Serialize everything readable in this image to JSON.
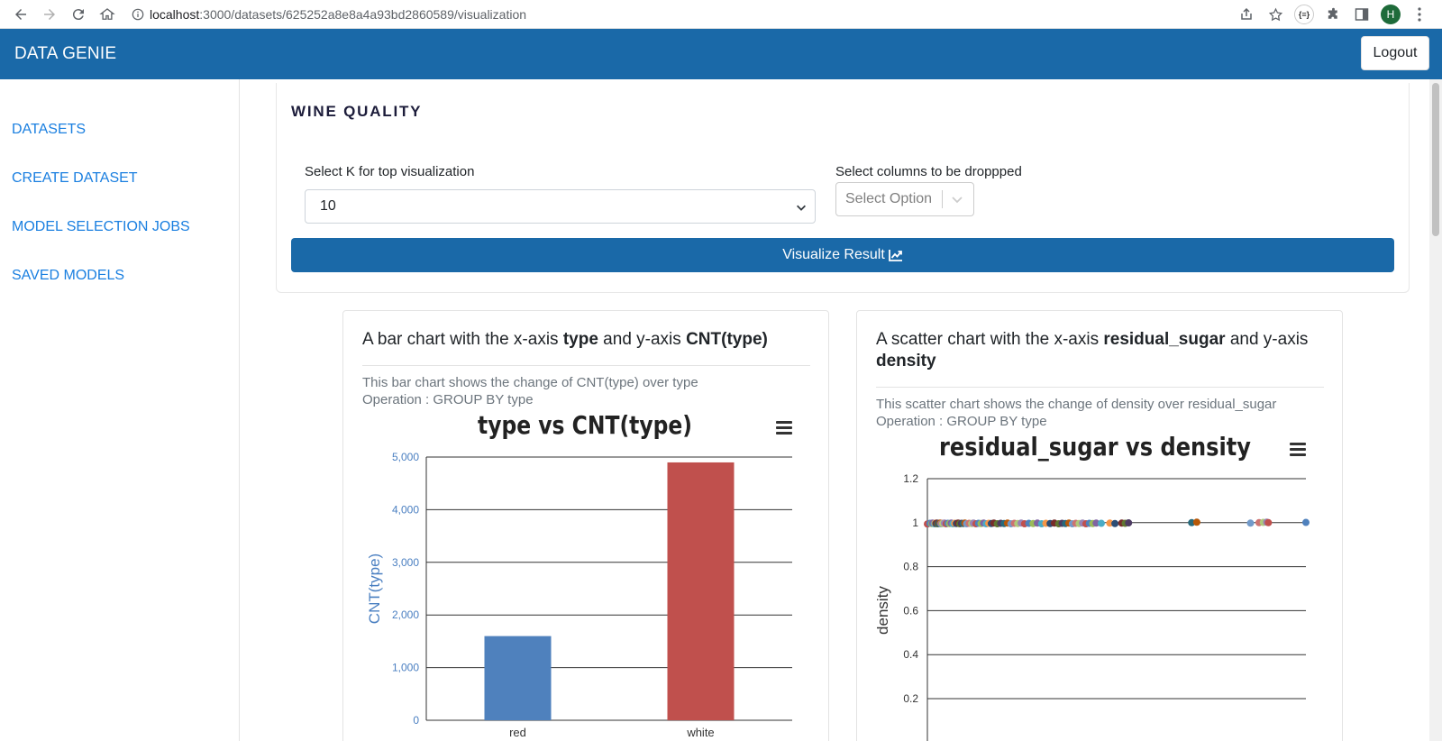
{
  "browser": {
    "url_host": "localhost",
    "url_rest": ":3000/datasets/625252a8e8a4a93bd2860589/visualization",
    "extension_badge": "{≡}",
    "profile_initial": "H"
  },
  "header": {
    "brand": "DATA GENIE",
    "logout_label": "Logout"
  },
  "sidebar": {
    "items": [
      {
        "label": "DATASETS"
      },
      {
        "label": "CREATE DATASET"
      },
      {
        "label": "MODEL SELECTION JOBS"
      },
      {
        "label": "SAVED MODELS"
      }
    ]
  },
  "main": {
    "dataset_title": "WINE QUALITY",
    "k_label": "Select K for top visualization",
    "k_value": "10",
    "cols_label": "Select columns to be droppped",
    "cols_placeholder": "Select Option",
    "visualize_label": "Visualize Result"
  },
  "cards": [
    {
      "title_pre": "A bar chart with the x-axis ",
      "title_x": "type",
      "title_mid": " and y-axis ",
      "title_y": "CNT(type)",
      "desc_line1": "This bar chart shows the change of CNT(type) over type",
      "desc_line2": "Operation : GROUP BY type"
    },
    {
      "title_pre": "A scatter chart with the x-axis ",
      "title_x": "residual_sugar",
      "title_mid": " and y-axis ",
      "title_y": "density",
      "desc_line1": "This scatter chart shows the change of density over residual_sugar",
      "desc_line2": "Operation : GROUP BY type"
    }
  ],
  "chart_data": [
    {
      "type": "bar",
      "title": "type  vs  CNT(type)",
      "ylabel": "CNT(type)",
      "ylim": [
        0,
        5000
      ],
      "yticks": [
        "5,000",
        "4,000",
        "3,000",
        "2,000",
        "1,000",
        "0"
      ],
      "categories": [
        "red",
        "white"
      ],
      "values": [
        1599,
        4898
      ],
      "colors": [
        "#4f81bd",
        "#c0504d"
      ],
      "grid": true
    },
    {
      "type": "scatter",
      "title": "residual_sugar  vs  density",
      "ylabel": "density",
      "ylim": [
        0.2,
        1.2
      ],
      "yticks": [
        "1.2",
        "1",
        "0.8",
        "0.6",
        "0.4",
        "0.2"
      ],
      "x": [
        0.6,
        0.9,
        1.1,
        1.2,
        1.4,
        1.5,
        1.6,
        1.7,
        1.8,
        1.9,
        2.0,
        2.1,
        2.2,
        2.3,
        2.4,
        2.6,
        2.8,
        3.0,
        3.2,
        3.4,
        3.6,
        3.8,
        4.0,
        4.2,
        4.4,
        4.6,
        4.8,
        5.0,
        5.2,
        5.5,
        5.8,
        6.0,
        6.3,
        6.6,
        6.9,
        7.2,
        7.5,
        7.8,
        8.1,
        8.4,
        8.8,
        9.2,
        9.6,
        10.0,
        10.4,
        10.8,
        11.2,
        11.6,
        12.0,
        12.5,
        13.0,
        13.5,
        14.0,
        14.5,
        15.0,
        15.5,
        16.0,
        16.4,
        16.8,
        17.2,
        17.6,
        18.0,
        18.4,
        18.8,
        19.2,
        19.6,
        20.0,
        20.4,
        21.0,
        22.0,
        22.6,
        23.4,
        23.8,
        24.2,
        31.6,
        32.2,
        38.5,
        39.5,
        40.0,
        40.4,
        40.6,
        45.0
      ],
      "y": [
        0.994,
        0.997,
        0.996,
        0.998,
        0.995,
        0.997,
        0.996,
        0.998,
        0.995,
        0.997,
        0.996,
        0.998,
        0.995,
        0.997,
        0.996,
        0.998,
        0.995,
        0.997,
        0.996,
        0.998,
        0.995,
        0.997,
        0.996,
        0.998,
        0.995,
        0.997,
        0.996,
        0.998,
        0.995,
        0.997,
        0.996,
        0.998,
        0.995,
        0.997,
        0.996,
        0.998,
        0.995,
        0.997,
        0.996,
        0.998,
        0.995,
        0.997,
        0.996,
        0.998,
        0.995,
        0.997,
        0.996,
        0.998,
        0.995,
        0.997,
        0.996,
        0.998,
        0.995,
        0.997,
        0.996,
        0.998,
        0.995,
        0.997,
        0.996,
        0.998,
        0.995,
        0.997,
        0.996,
        0.998,
        0.995,
        0.997,
        0.996,
        0.998,
        0.997,
        0.998,
        0.996,
        0.998,
        0.997,
        0.999,
        1.0,
        1.002,
        0.998,
        1.0,
        1.001,
        1.002,
        1.0,
        1.001
      ],
      "point_colors": [
        "#c0504d",
        "#4f81bd",
        "#9bbb59",
        "#8064a2",
        "#4bacc6",
        "#f79646",
        "#2c4d75",
        "#772c2a",
        "#5f7530",
        "#4d3b62",
        "#276a7c",
        "#b65708",
        "#729aca",
        "#cd7371",
        "#afc97a",
        "#9983b5"
      ],
      "grid": true
    }
  ]
}
